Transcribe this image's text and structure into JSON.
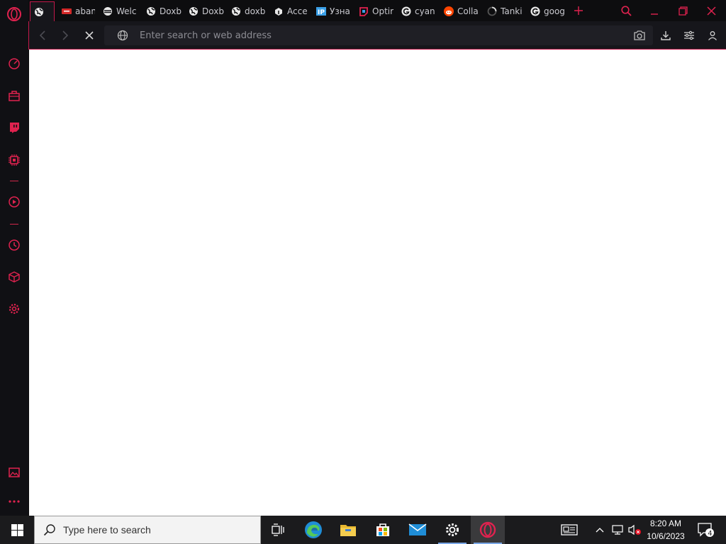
{
  "browser": {
    "tabs": [
      {
        "title": "",
        "icon": "globe-icon",
        "active": true
      },
      {
        "title": "aban",
        "icon": "red-rect-icon"
      },
      {
        "title": "Welc",
        "icon": "opera-gx-icon"
      },
      {
        "title": "Doxb",
        "icon": "globe-icon"
      },
      {
        "title": "Doxb",
        "icon": "globe-icon"
      },
      {
        "title": "doxb",
        "icon": "globe-icon"
      },
      {
        "title": "Acce",
        "icon": "puzzle-icon"
      },
      {
        "title": "Узна",
        "icon": "ip-icon"
      },
      {
        "title": "Optir",
        "icon": "optimizer-icon"
      },
      {
        "title": "cyan",
        "icon": "google-icon"
      },
      {
        "title": "Colla",
        "icon": "reddit-icon"
      },
      {
        "title": "Tanki",
        "icon": "loading-icon"
      },
      {
        "title": "goog",
        "icon": "google-icon"
      }
    ],
    "address_placeholder": "Enter search or web address",
    "address_value": ""
  },
  "taskbar": {
    "search_placeholder": "Type here to search",
    "time": "8:20 AM",
    "date": "10/6/2023",
    "notification_count": "4"
  },
  "colors": {
    "accent": "#e0224f",
    "sidebar_bg": "#101014",
    "taskbar_bg": "#1b1b1d"
  }
}
